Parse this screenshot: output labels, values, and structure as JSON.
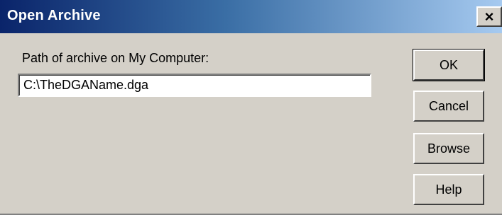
{
  "window": {
    "title": "Open Archive",
    "close_glyph": "×"
  },
  "form": {
    "path_label": "Path of archive on My Computer:",
    "path_value": "C:\\TheDGAName.dga"
  },
  "buttons": {
    "ok": "OK",
    "cancel": "Cancel",
    "browse": "Browse",
    "help": "Help"
  },
  "colors": {
    "title_gradient_start": "#0a246a",
    "title_gradient_end": "#a6caf0",
    "face": "#d4d0c8"
  },
  "icons": {
    "close": "close-icon"
  }
}
